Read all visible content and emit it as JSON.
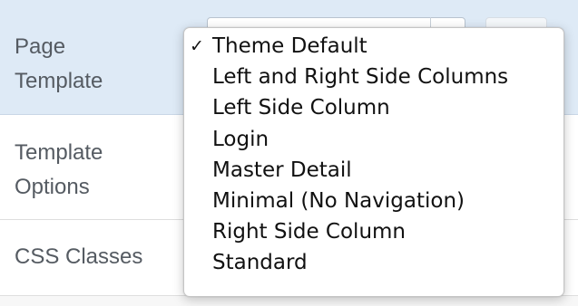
{
  "rows": {
    "page_template": {
      "label_line1": "Page",
      "label_line2": "Template"
    },
    "template_options": {
      "label_line1": "Template",
      "label_line2": "Options"
    },
    "css_classes": {
      "label": "CSS Classes"
    }
  },
  "dropdown": {
    "selected_index": 0,
    "check_glyph": "✓",
    "options": [
      "Theme Default",
      "Left and Right Side Columns",
      "Left Side Column",
      "Login",
      "Master Detail",
      "Minimal (No Navigation)",
      "Right Side Column",
      "Standard"
    ]
  },
  "colors": {
    "selected_row_bg": "#deeaf6",
    "label_text": "#555b62",
    "menu_text": "#111111"
  }
}
